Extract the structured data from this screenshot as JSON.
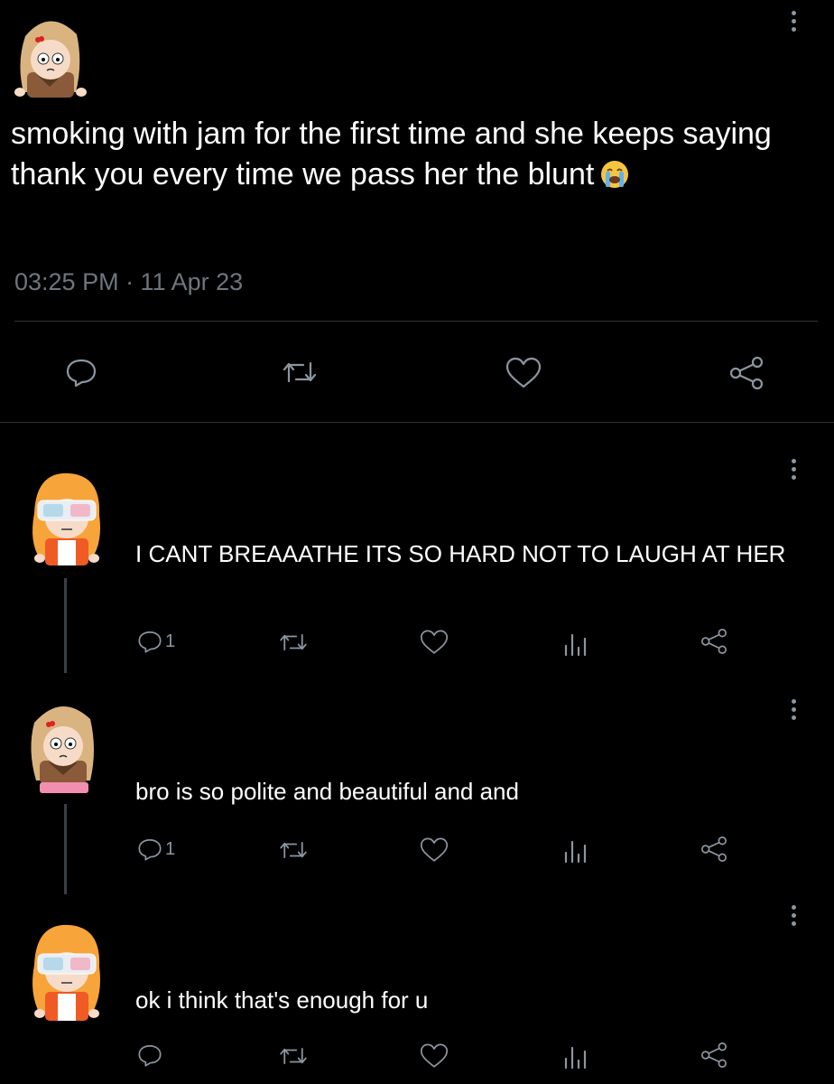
{
  "main_post": {
    "text": "smoking with jam for the first time and she keeps saying thank you every time we pass her  the blunt",
    "emoji": "😭",
    "timestamp": "03:25 PM · 11 Apr 23"
  },
  "replies": [
    {
      "text": "I CANT BREAAATHE ITS SO HARD NOT TO LAUGH AT HER",
      "reply_count": "1",
      "avatar": "orange-haired-3d-glasses"
    },
    {
      "text": "bro is so polite and beautiful and and",
      "reply_count": "1",
      "avatar": "blonde-haired"
    },
    {
      "text": "ok i think that's enough for u",
      "reply_count": "",
      "avatar": "orange-haired-3d-glasses"
    }
  ],
  "colors": {
    "background": "#000000",
    "text": "#ffffff",
    "muted": "#6e767d",
    "icon": "#8b96a0"
  }
}
